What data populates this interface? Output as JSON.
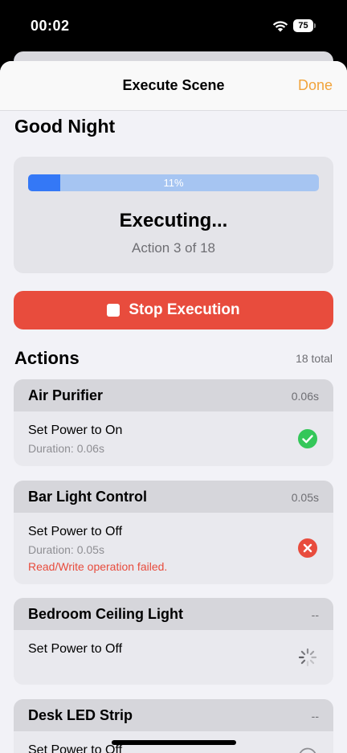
{
  "status_bar": {
    "time": "00:02",
    "battery": "75"
  },
  "nav": {
    "title": "Execute Scene",
    "done_label": "Done"
  },
  "scene": {
    "name": "Good Night"
  },
  "progress": {
    "percent_label": "11%",
    "fraction": 0.11,
    "title": "Executing...",
    "subtitle": "Action 3 of 18"
  },
  "stop_button": {
    "label": "Stop Execution"
  },
  "actions_section": {
    "title": "Actions",
    "count_label": "18 total"
  },
  "actions": [
    {
      "name": "Air Purifier",
      "time": "0.06s",
      "description": "Set Power to On",
      "duration": "Duration: 0.06s",
      "status": "success-icon"
    },
    {
      "name": "Bar Light Control",
      "time": "0.05s",
      "description": "Set Power to Off",
      "duration": "Duration: 0.05s",
      "error": "Read/Write operation failed.",
      "status": "error-icon"
    },
    {
      "name": "Bedroom Ceiling Light",
      "time": "--",
      "description": "Set Power to Off",
      "status": "loading-spinner-icon"
    },
    {
      "name": "Desk LED Strip",
      "time": "--",
      "description": "Set Power to Off",
      "status": "pending-icon"
    }
  ],
  "colors": {
    "accent": "#f1a33b",
    "progress": "#3478f6",
    "danger": "#e84c3d",
    "success": "#34c759"
  }
}
